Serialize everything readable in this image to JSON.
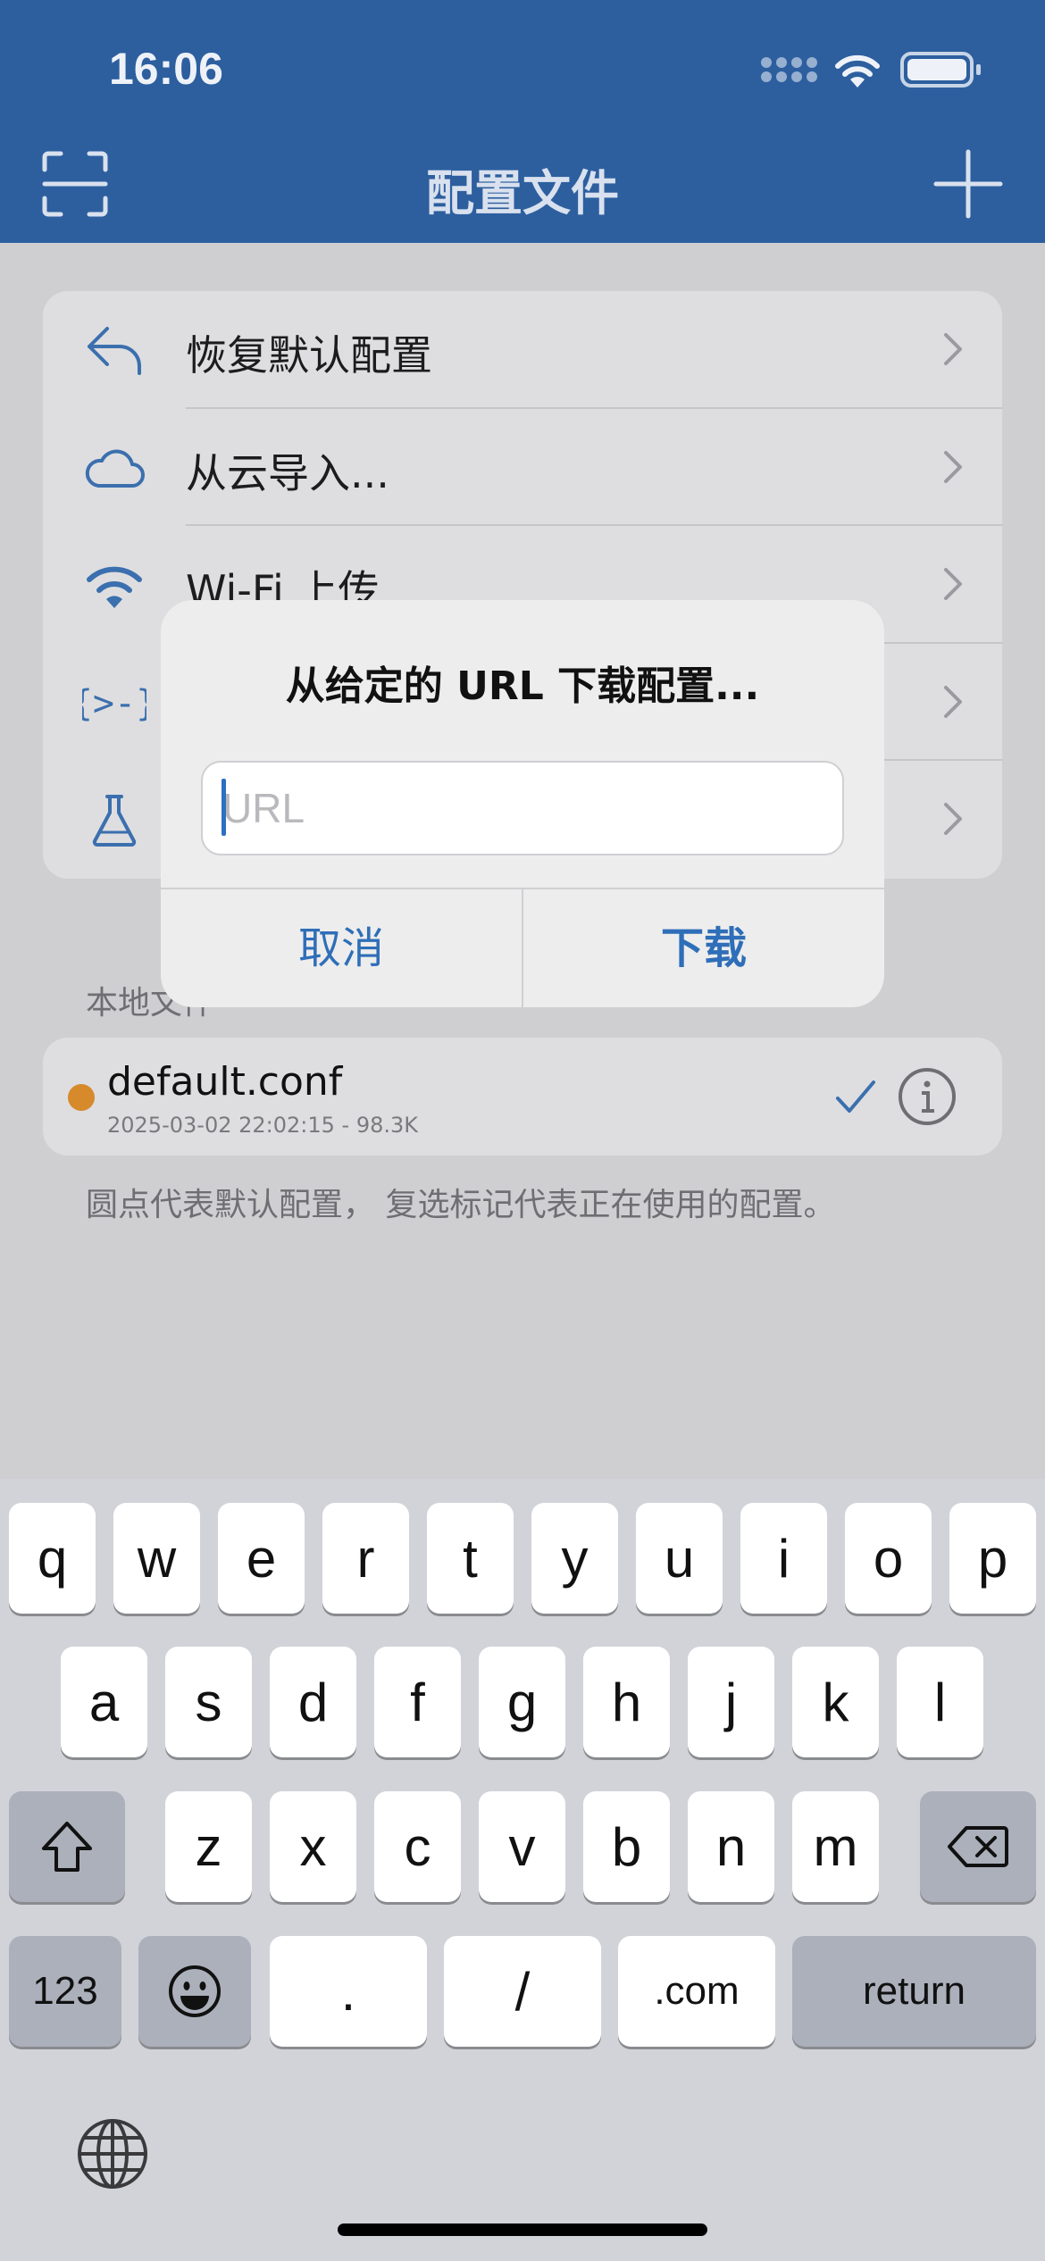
{
  "status_bar": {
    "time": "16:06"
  },
  "nav": {
    "title": "配置文件"
  },
  "menu": [
    {
      "label": "恢复默认配置",
      "icon": "undo-icon"
    },
    {
      "label": "从云导入...",
      "icon": "cloud-icon"
    },
    {
      "label": "Wi-Fi 上传",
      "icon": "wifi-icon"
    },
    {
      "label": "",
      "icon": "code-icon"
    },
    {
      "label": "",
      "icon": "flask-icon"
    }
  ],
  "local_files": {
    "section_label": "本地文件",
    "files": [
      {
        "name": "default.conf",
        "meta": "2025-03-02 22:02:15 - 98.3K",
        "dot_color": "#d68a2c"
      }
    ],
    "footnote": "圆点代表默认配置， 复选标记代表正在使用的配置。"
  },
  "alert": {
    "title": "从给定的 URL 下载配置...",
    "input_placeholder": "URL",
    "input_value": "",
    "cancel_label": "取消",
    "download_label": "下载"
  },
  "keyboard": {
    "row1": [
      "q",
      "w",
      "e",
      "r",
      "t",
      "y",
      "u",
      "i",
      "o",
      "p"
    ],
    "row2": [
      "a",
      "s",
      "d",
      "f",
      "g",
      "h",
      "j",
      "k",
      "l"
    ],
    "row3": [
      "z",
      "x",
      "c",
      "v",
      "b",
      "n",
      "m"
    ],
    "numbers_label": "123",
    "dot_label": ".",
    "slash_label": "/",
    "dotcom_label": ".com",
    "return_label": "return"
  },
  "colors": {
    "nav_background": "#2d5f9f",
    "accent": "#2f6eb8",
    "default_dot": "#d68a2c"
  }
}
